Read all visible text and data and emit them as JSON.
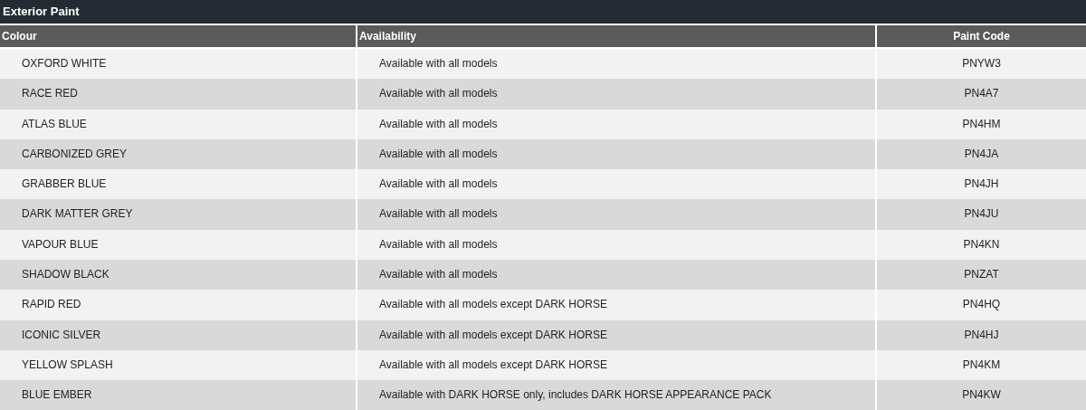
{
  "title": "Exterior Paint",
  "table": {
    "columns": [
      "Colour",
      "Availability",
      "Paint Code"
    ],
    "rows": [
      [
        "OXFORD WHITE",
        "Available with all models",
        "PNYW3"
      ],
      [
        "RACE RED",
        "Available with all models",
        "PN4A7"
      ],
      [
        "ATLAS BLUE",
        "Available with all models",
        "PN4HM"
      ],
      [
        "CARBONIZED GREY",
        "Available with all models",
        "PN4JA"
      ],
      [
        "GRABBER BLUE",
        "Available with all models",
        "PN4JH"
      ],
      [
        "DARK MATTER GREY",
        "Available with all models",
        "PN4JU"
      ],
      [
        "VAPOUR BLUE",
        "Available with all models",
        "PN4KN"
      ],
      [
        "SHADOW BLACK",
        "Available with all models",
        "PNZAT"
      ],
      [
        "RAPID RED",
        "Available with all models except DARK HORSE",
        "PN4HQ"
      ],
      [
        "ICONIC SILVER",
        "Available with all models except DARK HORSE",
        "PN4HJ"
      ],
      [
        "YELLOW SPLASH",
        "Available with all models except DARK HORSE",
        "PN4KM"
      ],
      [
        "BLUE EMBER",
        "Available with DARK HORSE only, includes DARK HORSE APPEARANCE PACK",
        "PN4KW"
      ]
    ]
  }
}
